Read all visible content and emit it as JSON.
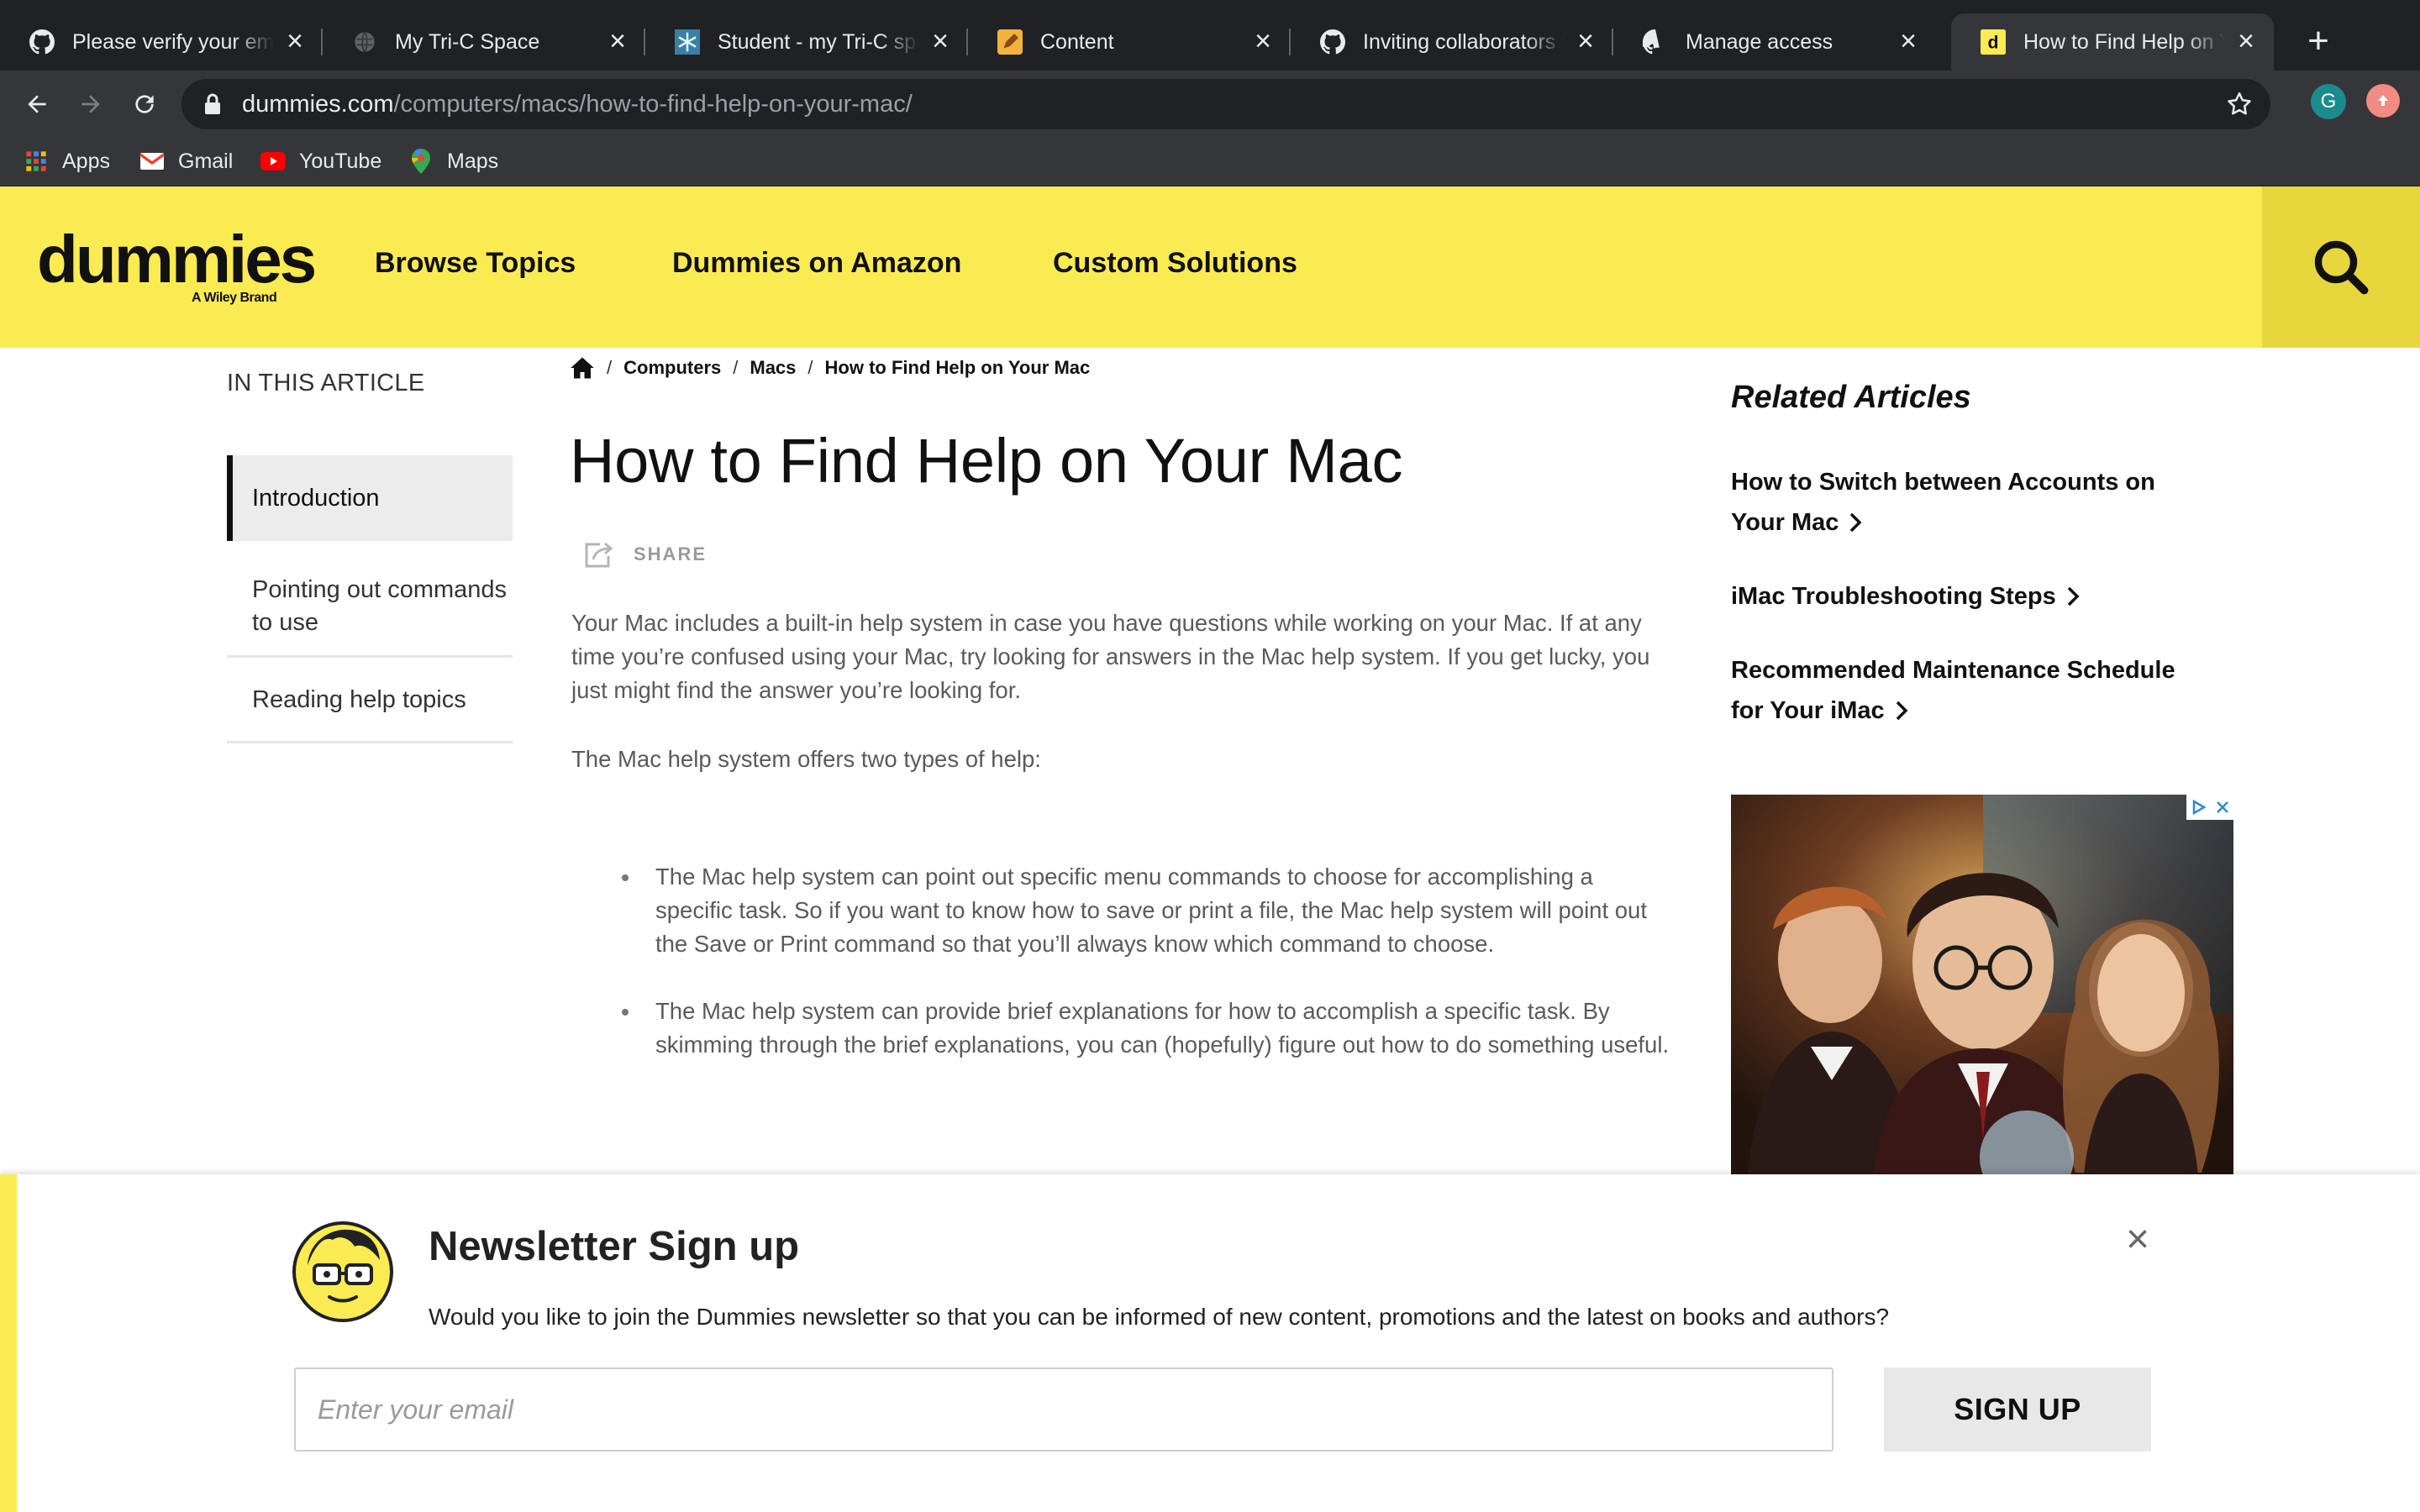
{
  "browser": {
    "tabs": [
      {
        "title": "Please verify your email",
        "favicon": "github-icon",
        "active": false
      },
      {
        "title": "My Tri-C Space",
        "favicon": "globe-icon",
        "active": false
      },
      {
        "title": "Student - my Tri-C space",
        "favicon": "snowflake-icon",
        "active": false
      },
      {
        "title": "Content",
        "favicon": "pencil-icon",
        "active": false
      },
      {
        "title": "Inviting collaborators to",
        "favicon": "github-icon",
        "active": false
      },
      {
        "title": "Manage access",
        "favicon": "github-icon",
        "active": false
      },
      {
        "title": "How to Find Help on Your Mac",
        "favicon": "dummies-icon",
        "active": true
      }
    ],
    "url_host": "dummies.com",
    "url_path": "/computers/macs/how-to-find-help-on-your-mac/",
    "profile_initial": "G",
    "bookmarks": [
      {
        "label": "Apps",
        "icon": "apps-grid-icon"
      },
      {
        "label": "Gmail",
        "icon": "gmail-icon"
      },
      {
        "label": "YouTube",
        "icon": "youtube-icon"
      },
      {
        "label": "Maps",
        "icon": "maps-pin-icon"
      }
    ]
  },
  "site": {
    "logo_word": "dummies",
    "logo_sub": "A Wiley Brand",
    "nav": [
      "Browse Topics",
      "Dummies on Amazon",
      "Custom Solutions"
    ],
    "brand_color": "#fbeb52"
  },
  "toc": {
    "heading": "IN THIS ARTICLE",
    "items": [
      "Introduction",
      "Pointing out commands to use",
      "Reading help topics"
    ],
    "active_index": 0
  },
  "article": {
    "breadcrumb": [
      "Computers",
      "Macs",
      "How to Find Help on Your Mac"
    ],
    "title": "How to Find Help on Your Mac",
    "share_label": "SHARE",
    "paragraphs": [
      "Your Mac includes a built-in help system in case you have questions while working on your Mac. If at any time you’re confused using your Mac, try looking for answers in the Mac help system. If you get lucky, you just might find the answer you’re looking for.",
      "The Mac help system offers two types of help:"
    ],
    "bullets": [
      "The Mac help system can point out specific menu commands to choose for accomplishing a specific task. So if you want to know how to save or print a file, the Mac help system will point out the Save or Print command so that you’ll always know which command to choose.",
      "The Mac help system can provide brief explanations for how to accomplish a specific task. By skimming through the brief explanations, you can (hopefully) figure out how to do something useful."
    ]
  },
  "related": {
    "heading": "Related Articles",
    "links": [
      "How to Switch between Accounts on Your Mac",
      "iMac Troubleshooting Steps",
      "Recommended Maintenance Schedule for Your iMac"
    ]
  },
  "newsletter": {
    "title": "Newsletter Sign up",
    "description": "Would you like to join the Dummies newsletter so that you can be informed of new content, promotions and the latest on books and authors?",
    "email_placeholder": "Enter your email",
    "email_value": "",
    "button_label": "SIGN UP"
  }
}
